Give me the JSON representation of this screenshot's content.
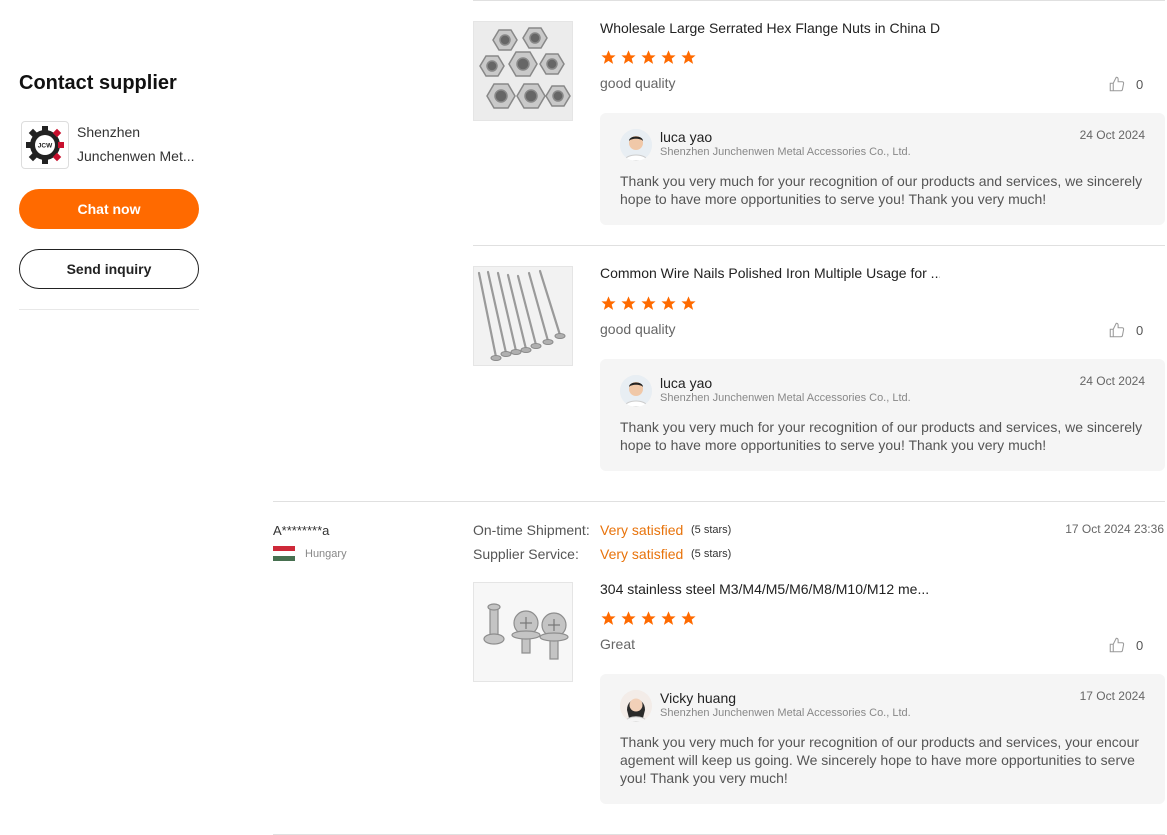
{
  "sidebar": {
    "title": "Contact supplier",
    "supplier_name_line1": "Shenzhen",
    "supplier_name_line2": "Junchenwen Met...",
    "logo_text": "JCW",
    "chat_label": "Chat now",
    "inquiry_label": "Send inquiry"
  },
  "reviews": [
    {
      "product_title": "Wholesale Large Serrated Hex Flange Nuts in China D...",
      "rating": 5,
      "text": "good quality",
      "likes": "0",
      "reply": {
        "name": "luca yao",
        "company": "Shenzhen Junchenwen Metal Accessories Co., Ltd.",
        "date": "24 Oct 2024",
        "text": "Thank you very much for your recognition of our products and services, we sincerely hope to have more opportunities to serve you! Thank you very much!"
      }
    },
    {
      "product_title": "Common Wire Nails Polished Iron Multiple Usage for ...",
      "rating": 5,
      "text": "good quality",
      "likes": "0",
      "reply": {
        "name": "luca yao",
        "company": "Shenzhen Junchenwen Metal Accessories Co., Ltd.",
        "date": "24 Oct 2024",
        "text": "Thank you very much for your recognition of our products and services, we sincerely hope to have more opportunities to serve you! Thank you very much!"
      }
    }
  ],
  "reviewer": {
    "name": "A********a",
    "country": "Hungary",
    "date": "17 Oct 2024 23:36",
    "metrics": [
      {
        "label": "On-time Shipment:",
        "value": "Very satisfied",
        "stars": "(5 stars)"
      },
      {
        "label": "Supplier Service:",
        "value": "Very satisfied",
        "stars": "(5 stars)"
      }
    ],
    "product_title": "304 stainless steel M3/M4/M5/M6/M8/M10/M12 me...",
    "rating": 5,
    "text": "Great",
    "likes": "0",
    "reply": {
      "name": "Vicky huang",
      "company": "Shenzhen Junchenwen Metal Accessories Co., Ltd.",
      "date": "17 Oct 2024",
      "text": "Thank you very much for your recognition of our products and services, your encouragement will keep us going. We sincerely hope to have more opportunities to serve you! Thank you very much!"
    }
  },
  "colors": {
    "accent": "#ff6a00",
    "star": "#ff6a00",
    "satisfied": "#e8730b",
    "reply_bg": "#f5f5f5"
  },
  "icons": {
    "star": "star-icon",
    "like": "thumbs-up-icon",
    "logo": "gear-logo-icon"
  }
}
